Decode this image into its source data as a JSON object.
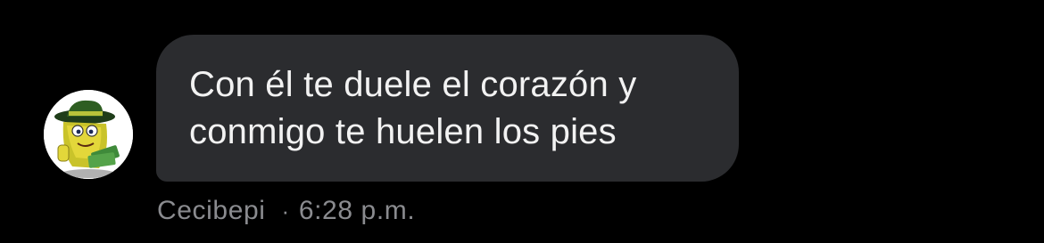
{
  "message": {
    "text": "Con él te duele el corazón y\nconmigo te huelen los pies",
    "sender": "Cecibepi",
    "separator": "·",
    "time": "6:28 p.m."
  },
  "avatar": {
    "icon": "cartoon-avatar-icon"
  },
  "colors": {
    "background": "#000000",
    "bubble": "#2b2c2f",
    "text": "#f2f2f2",
    "meta": "#8a8b8f"
  }
}
